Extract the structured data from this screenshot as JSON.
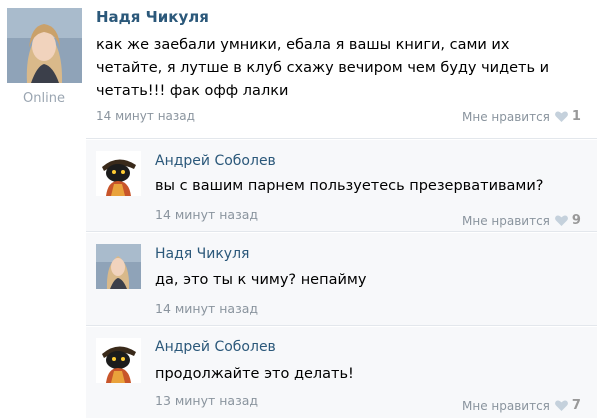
{
  "post": {
    "author": "Надя Чикуля",
    "status": "Online",
    "text": "как же заебали умники, ебала я вашы книги, сами их четайте, я лутше в клуб схажу вечиром чем буду чидеть и четать!!! фак офф лалки",
    "time": "14 минут назад",
    "like_label": "Мне нравится",
    "like_count": "1"
  },
  "replies": [
    {
      "author": "Андрей Соболев",
      "text": "вы с вашим парнем пользуетесь презервативами?",
      "time": "14 минут назад",
      "like_label": "Мне нравится",
      "like_count": "9"
    },
    {
      "author": "Надя Чикуля",
      "text": "да, это  ты к чиму? непайму",
      "time": "14 минут назад"
    },
    {
      "author": "Андрей Соболев",
      "text": "продолжайте это делать!",
      "time": "13 минут назад",
      "like_label": "Мне нравится",
      "like_count": "7"
    }
  ],
  "colors": {
    "link": "#2b587a",
    "muted": "#8a949e",
    "reply_bg": "#f7f8fa",
    "heart": "#c5d1dc"
  },
  "icons": {
    "like": "heart-icon"
  }
}
